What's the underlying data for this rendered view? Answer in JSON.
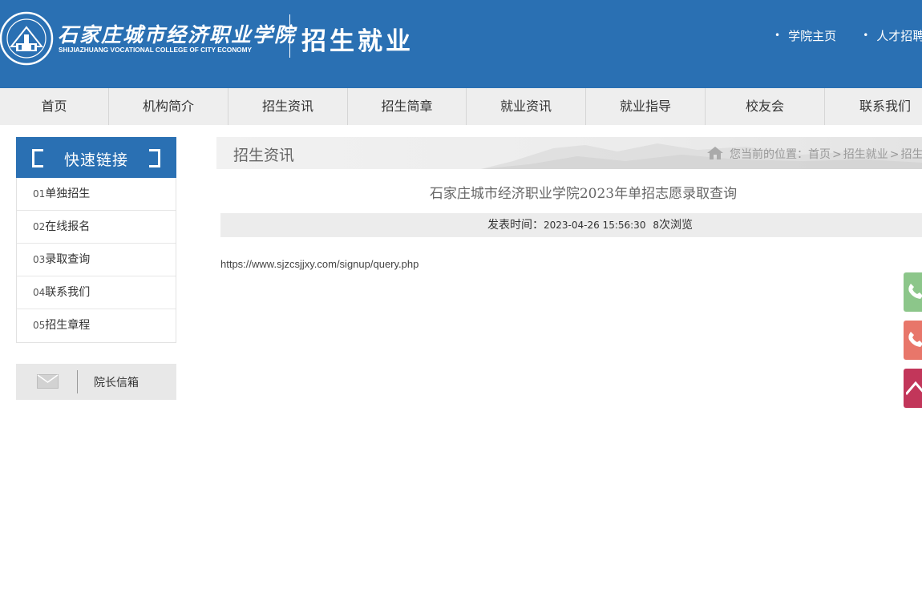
{
  "header": {
    "logo_cn": "石家庄城市经济职业学院",
    "logo_en": "SHIJIAZHUANG VOCATIONAL COLLEGE OF CITY ECONOMY",
    "site_title": "招生就业",
    "top_links": [
      {
        "label": "学院主页"
      },
      {
        "label": "人才招聘"
      }
    ],
    "background_color": "#2a70b3"
  },
  "nav": {
    "items": [
      {
        "label": "首页"
      },
      {
        "label": "机构简介"
      },
      {
        "label": "招生资讯"
      },
      {
        "label": "招生简章"
      },
      {
        "label": "就业资讯"
      },
      {
        "label": "就业指导"
      },
      {
        "label": "校友会"
      },
      {
        "label": "联系我们"
      }
    ]
  },
  "sidebar": {
    "title": "快速链接",
    "items": [
      {
        "num": "01",
        "label": "单独招生"
      },
      {
        "num": "02",
        "label": "在线报名"
      },
      {
        "num": "03",
        "label": "录取查询"
      },
      {
        "num": "04",
        "label": "联系我们"
      },
      {
        "num": "05",
        "label": "招生章程"
      }
    ],
    "mailbox_label": "院长信箱"
  },
  "main": {
    "section_title": "招生资讯",
    "breadcrumb": {
      "prefix": "您当前的位置：",
      "items": [
        "首页",
        "招生就业",
        "招生资讯"
      ],
      "separator": ">"
    },
    "article": {
      "title": "石家庄城市经济职业学院2023年单招志愿录取查询",
      "published_label": "发表时间：",
      "published_time": "2023-04-26 15:56:30",
      "views_count": "8",
      "views_suffix": "次浏览",
      "body": "https://www.sjzcsjjxy.com/signup/query.php"
    }
  },
  "float_buttons": [
    {
      "icon": "phone-icon",
      "color": "#8cc68a"
    },
    {
      "icon": "phone-icon",
      "color": "#e8766a"
    },
    {
      "icon": "arrow-up-icon",
      "color": "#c2365a"
    }
  ]
}
